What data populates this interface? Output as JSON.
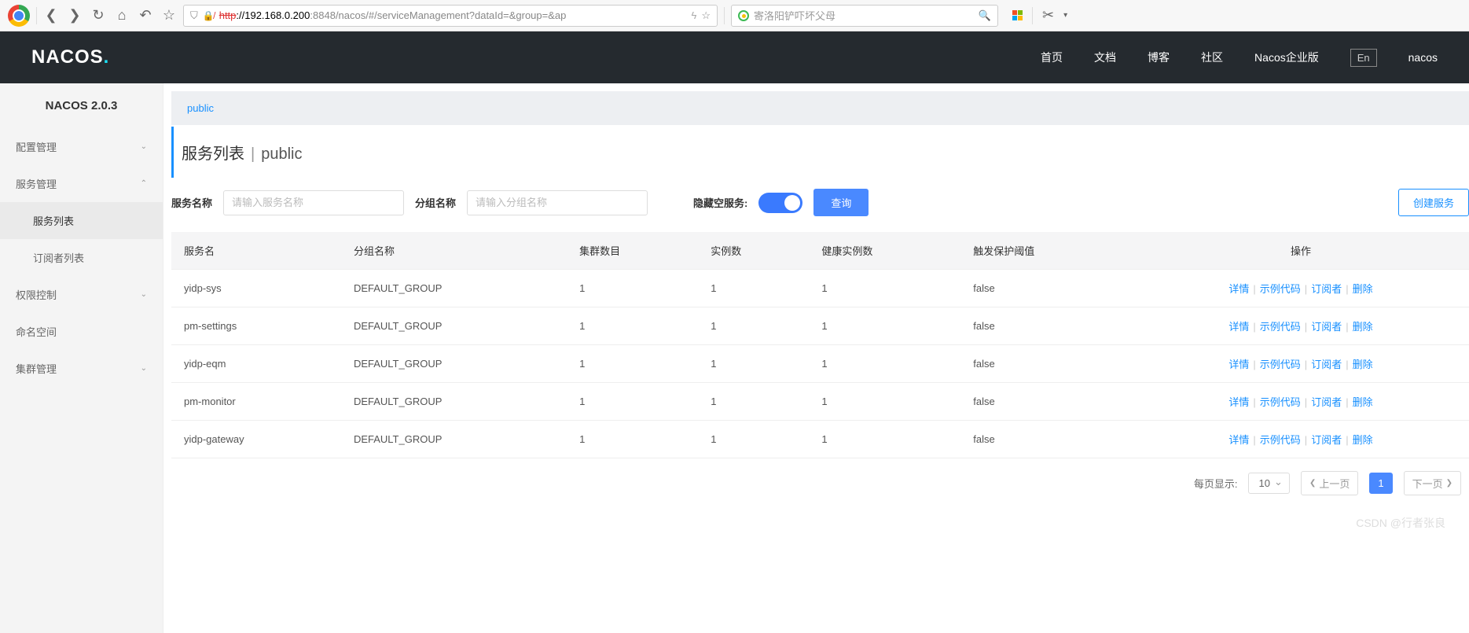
{
  "browser": {
    "url_proto": "http",
    "url_host_bold": "://192.168.0.200",
    "url_port": ":8848",
    "url_path": "/nacos/#/serviceManagement?dataId=&group=&ap",
    "search_placeholder": "寄洛阳铲吓坏父母"
  },
  "header": {
    "logo_text": "NACOS",
    "nav": [
      "首页",
      "文档",
      "博客",
      "社区",
      "Nacos企业版"
    ],
    "lang": "En",
    "user": "nacos"
  },
  "sidebar": {
    "title": "NACOS 2.0.3",
    "menus": [
      {
        "label": "配置管理",
        "expanded": false
      },
      {
        "label": "服务管理",
        "expanded": true,
        "children": [
          "服务列表",
          "订阅者列表"
        ],
        "active": 0
      },
      {
        "label": "权限控制",
        "expanded": false
      },
      {
        "label": "命名空间",
        "expanded": null
      },
      {
        "label": "集群管理",
        "expanded": false
      }
    ]
  },
  "page": {
    "namespace_tab": "public",
    "title": "服务列表",
    "title_ns": "public",
    "filter": {
      "name_label": "服务名称",
      "name_placeholder": "请输入服务名称",
      "group_label": "分组名称",
      "group_placeholder": "请输入分组名称",
      "hide_empty_label": "隐藏空服务:",
      "search_btn": "查询",
      "create_btn": "创建服务"
    },
    "columns": [
      "服务名",
      "分组名称",
      "集群数目",
      "实例数",
      "健康实例数",
      "触发保护阈值",
      "操作"
    ],
    "rows": [
      {
        "name": "yidp-sys",
        "group": "DEFAULT_GROUP",
        "clusters": "1",
        "instances": "1",
        "healthy": "1",
        "threshold": "false"
      },
      {
        "name": "pm-settings",
        "group": "DEFAULT_GROUP",
        "clusters": "1",
        "instances": "1",
        "healthy": "1",
        "threshold": "false"
      },
      {
        "name": "yidp-eqm",
        "group": "DEFAULT_GROUP",
        "clusters": "1",
        "instances": "1",
        "healthy": "1",
        "threshold": "false"
      },
      {
        "name": "pm-monitor",
        "group": "DEFAULT_GROUP",
        "clusters": "1",
        "instances": "1",
        "healthy": "1",
        "threshold": "false"
      },
      {
        "name": "yidp-gateway",
        "group": "DEFAULT_GROUP",
        "clusters": "1",
        "instances": "1",
        "healthy": "1",
        "threshold": "false"
      }
    ],
    "actions": {
      "detail": "详情",
      "code": "示例代码",
      "subscribers": "订阅者",
      "delete": "删除"
    },
    "pagination": {
      "per_page_label": "每页显示:",
      "per_page": "10",
      "prev": "上一页",
      "current": "1",
      "next": "下一页"
    },
    "watermark": "CSDN @行者张良"
  }
}
